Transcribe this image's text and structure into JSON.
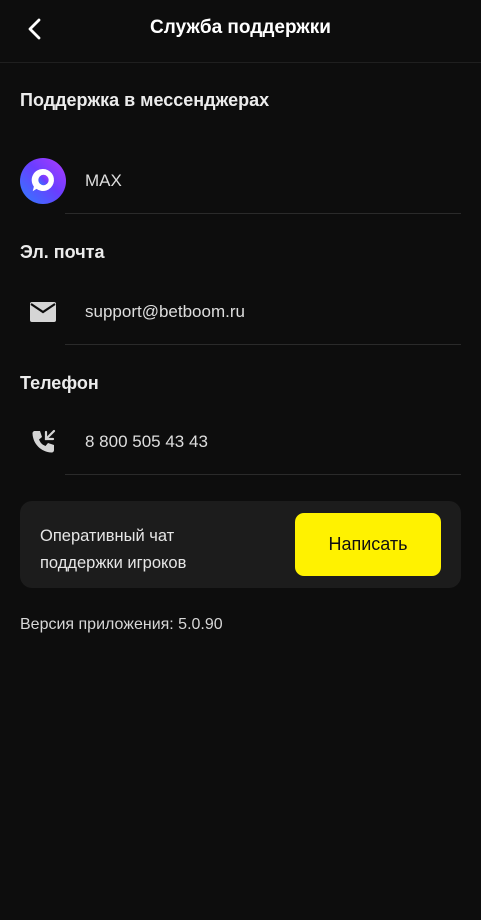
{
  "header": {
    "title": "Служба поддержки",
    "back_icon": "chevron-left-icon"
  },
  "messengers": {
    "title": "Поддержка в мессенджерах",
    "items": [
      {
        "label": "MAX",
        "icon": "max-messenger-icon"
      }
    ]
  },
  "email": {
    "title": "Эл. почта",
    "value": "support@betboom.ru",
    "icon": "mail-icon"
  },
  "phone": {
    "title": "Телефон",
    "value": "8 800 505 43 43",
    "icon": "phone-icon"
  },
  "chat_card": {
    "text_line1": "Оперативный чат",
    "text_line2": "поддержки игроков",
    "button_label": "Написать",
    "button_color": "#fff200"
  },
  "footer": {
    "version_text": "Версия приложения: 5.0.90"
  },
  "colors": {
    "background": "#0d0d0d",
    "card": "#1c1c1c",
    "accent": "#fff200"
  }
}
